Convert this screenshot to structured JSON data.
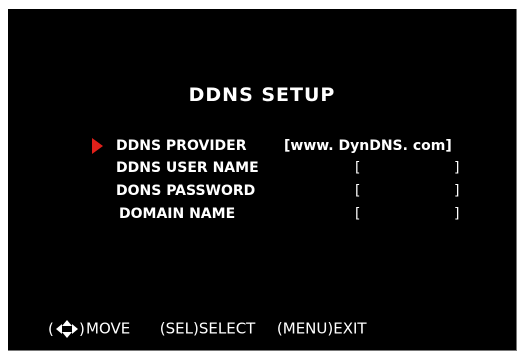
{
  "screen": {
    "title": "DDNS SETUP"
  },
  "settings": {
    "rows": [
      {
        "label": "DDNS PROVIDER",
        "value": "[www. DynDNS. com]",
        "selected": true
      },
      {
        "label": "DDNS USER NAME",
        "open_bracket": "[",
        "close_bracket": "]",
        "selected": false
      },
      {
        "label": "DONS PASSWORD",
        "open_bracket": "[",
        "close_bracket": "]",
        "selected": false
      },
      {
        "label": "DOMAIN NAME",
        "open_bracket": "[",
        "close_bracket": "]",
        "selected": false
      }
    ]
  },
  "footer": {
    "move_icon": "four-direction-arrows-icon",
    "move_label": "MOVE",
    "select_key": "(SEL)",
    "select_label": "SELECT",
    "menu_key": "(MENU)",
    "exit_label": "EXIT"
  },
  "colors": {
    "background": "#000000",
    "text": "#ffffff",
    "pointer": "#e0201a"
  }
}
